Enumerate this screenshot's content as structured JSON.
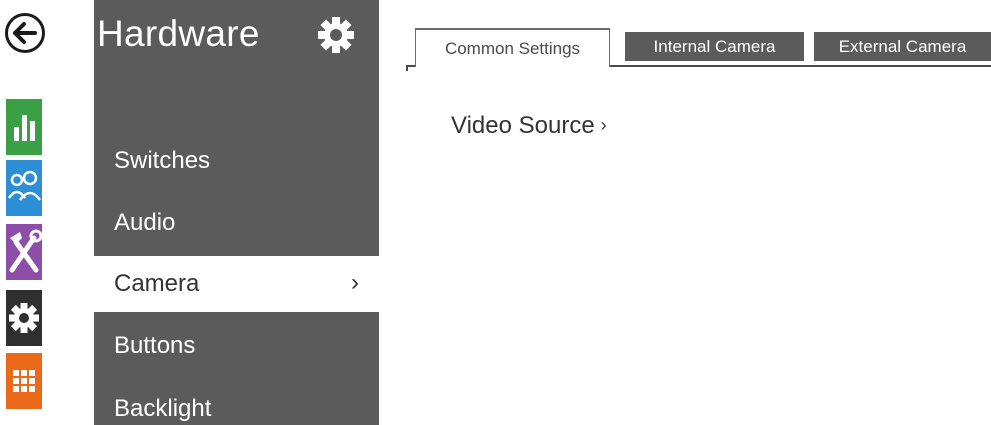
{
  "rail": {
    "back": "back-icon",
    "items": [
      {
        "icon": "status-chart-icon",
        "color": "#3aa046"
      },
      {
        "icon": "users-icon",
        "color": "#2c8fd6"
      },
      {
        "icon": "services-tools-icon",
        "color": "#8d4ea8"
      },
      {
        "icon": "hardware-gear-icon",
        "color": "#2f2f2f"
      },
      {
        "icon": "system-grid-icon",
        "color": "#ea6a1a"
      }
    ]
  },
  "panel": {
    "title": "Hardware",
    "title_icon": "gear-icon",
    "bg_color": "#5b5b5b",
    "items": [
      {
        "label": "Switches"
      },
      {
        "label": "Audio"
      },
      {
        "label": "Camera",
        "active": true,
        "chevron": "›"
      },
      {
        "label": "Buttons"
      },
      {
        "label": "Backlight"
      }
    ]
  },
  "tabs": [
    {
      "label": "Common Settings",
      "active": true
    },
    {
      "label": "Internal Camera",
      "active": false
    },
    {
      "label": "External Camera",
      "active": false
    }
  ],
  "main": {
    "section_label": "Video Source",
    "section_chevron": "›"
  }
}
